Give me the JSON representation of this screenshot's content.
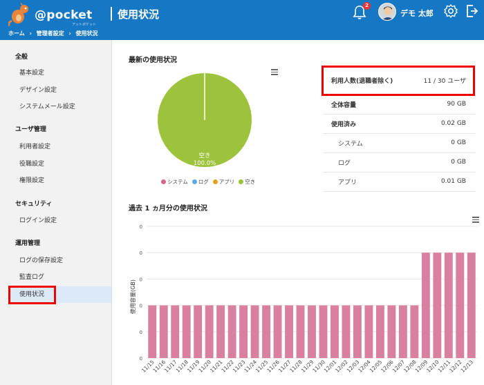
{
  "header": {
    "brand": "@pocket",
    "brand_sub": "アットポケット",
    "page_title": "使用状況",
    "notification_count": "2",
    "user_name": "デモ 太郎",
    "breadcrumb": [
      "ホーム",
      "管理者設定",
      "使用状況"
    ]
  },
  "sidebar": {
    "sections": [
      {
        "title": "全般",
        "items": [
          "基本設定",
          "デザイン設定",
          "システムメール設定"
        ]
      },
      {
        "title": "ユーザ管理",
        "items": [
          "利用者設定",
          "役職設定",
          "権限設定"
        ]
      },
      {
        "title": "セキュリティ",
        "items": [
          "ログイン設定"
        ]
      },
      {
        "title": "運用管理",
        "items": [
          "ログの保存設定",
          "監査ログ",
          "使用状況"
        ]
      }
    ],
    "active_item": "使用状況"
  },
  "latest": {
    "title": "最新の使用状況",
    "pie_label": "空き",
    "pie_value": "100.0%",
    "legend": [
      {
        "name": "システム",
        "color": "#d2688f"
      },
      {
        "name": "ログ",
        "color": "#5fa8e8"
      },
      {
        "name": "アプリ",
        "color": "#e8a321"
      },
      {
        "name": "空き",
        "color": "#9dc23b"
      }
    ]
  },
  "usage_table": [
    {
      "label": "利用人数(退職者除く)",
      "value": "11 / 30 ユーザ",
      "style": "bold"
    },
    {
      "label": "全体容量",
      "value": "90 GB",
      "style": "bold"
    },
    {
      "label": "使用済み",
      "value": "0.02 GB",
      "style": "bold"
    },
    {
      "label": "システム",
      "value": "0 GB",
      "style": "sub"
    },
    {
      "label": "ログ",
      "value": "0 GB",
      "style": "sub"
    },
    {
      "label": "アプリ",
      "value": "0.01 GB",
      "style": "sub"
    }
  ],
  "monthly": {
    "title": "過去 1 ヵ月分の使用状況"
  },
  "chart_data": [
    {
      "type": "pie",
      "title": "最新の使用状況",
      "categories": [
        "システム",
        "ログ",
        "アプリ",
        "空き"
      ],
      "values": [
        0.0,
        0.0,
        0.0,
        100.0
      ],
      "colors": [
        "#d2688f",
        "#5fa8e8",
        "#e8a321",
        "#9dc23b"
      ]
    },
    {
      "type": "bar",
      "title": "過去 1 ヵ月分の使用状況",
      "ylabel": "使用容量(GB)",
      "ytick_labels": [
        "0",
        "0",
        "0",
        "0",
        "0",
        "0"
      ],
      "categories": [
        "11/15",
        "11/16",
        "11/17",
        "11/18",
        "11/19",
        "11/20",
        "11/21",
        "11/22",
        "11/23",
        "11/24",
        "11/25",
        "11/26",
        "11/27",
        "11/28",
        "11/29",
        "11/30",
        "12/01",
        "12/02",
        "12/03",
        "12/04",
        "12/05",
        "12/06",
        "12/07",
        "12/08",
        "12/09",
        "12/10",
        "12/11",
        "12/12",
        "12/13"
      ],
      "values": [
        0.01,
        0.01,
        0.01,
        0.01,
        0.01,
        0.01,
        0.01,
        0.01,
        0.01,
        0.01,
        0.01,
        0.01,
        0.01,
        0.01,
        0.01,
        0.01,
        0.01,
        0.01,
        0.01,
        0.01,
        0.01,
        0.01,
        0.01,
        0.01,
        0.02,
        0.02,
        0.02,
        0.02,
        0.02
      ],
      "ylim": [
        0,
        0.025
      ],
      "color": "#d97f9f"
    }
  ]
}
